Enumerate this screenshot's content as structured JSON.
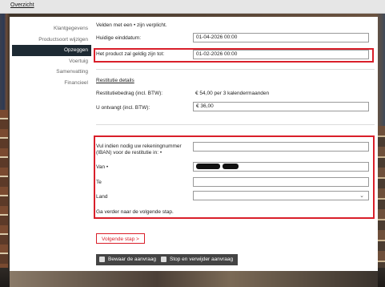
{
  "topbar": {
    "link": "Overzicht"
  },
  "sidebar": {
    "items": [
      {
        "label": "Klantgegevens",
        "active": false
      },
      {
        "label": "Productsoort wijzigen",
        "active": false
      },
      {
        "label": "Opzeggen",
        "active": true
      },
      {
        "label": "Voertuig",
        "active": false
      },
      {
        "label": "Samenvatting",
        "active": false
      },
      {
        "label": "Financieel",
        "active": false
      }
    ]
  },
  "form": {
    "required_note": "Velden met een • zijn verplicht.",
    "huidige_einddatum_label": "Huidige einddatum:",
    "huidige_einddatum_value": "01-04-2026 00:00",
    "geldig_tot_label": "Het product zal geldig zijn tot:",
    "geldig_tot_value": "01-02-2026 00:00",
    "restitutie_heading": "Restitutie details",
    "restitutiebedrag_label": "Restitutiebedrag (incl. BTW):",
    "restitutiebedrag_value": "€ 54,00 per 3 kalendermaanden",
    "ontvangt_label": "U ontvangt (incl. BTW):",
    "ontvangt_value": "€ 36,00",
    "iban_label_line1": "Vul indien nodig uw rekeningnummer",
    "iban_label_line2": "(IBAN) voor de restitutie in: •",
    "iban_value": "",
    "van_label": "Van •",
    "te_label": "Te",
    "te_value": "",
    "land_label": "Land",
    "land_value": "",
    "next_step_note": "Ga verder naar de volgende stap."
  },
  "buttons": {
    "next": "Volgende stap >",
    "save": "Bewaar de aanvraag",
    "stop": "Stop en verwijder aanvraag"
  },
  "colors": {
    "accent_red": "#d91f2a",
    "sidebar_active": "#1d2a33",
    "dark_button": "#444444"
  }
}
